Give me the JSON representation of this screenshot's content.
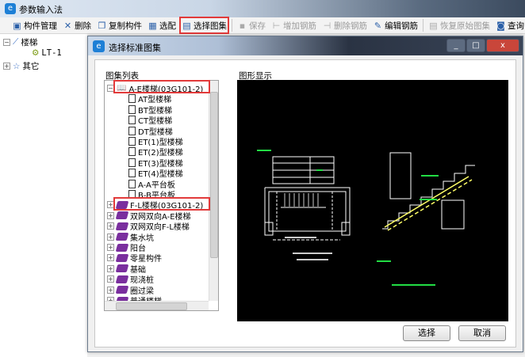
{
  "window": {
    "title": "参数输入法"
  },
  "toolbar": {
    "items": [
      {
        "label": "构件管理",
        "icon": "component-manage-icon",
        "enabled": true
      },
      {
        "label": "删除",
        "icon": "delete-x-icon",
        "enabled": true
      },
      {
        "label": "复制构件",
        "icon": "copy-icon",
        "enabled": true
      },
      {
        "label": "选配",
        "icon": "select-match-icon",
        "enabled": true
      },
      {
        "label": "选择图集",
        "icon": "atlas-icon",
        "enabled": true,
        "highlighted": true
      },
      {
        "label": "保存",
        "icon": "save-icon",
        "enabled": false
      },
      {
        "label": "增加钢筋",
        "icon": "add-rebar-icon",
        "enabled": false
      },
      {
        "label": "删除钢筋",
        "icon": "delete-rebar-icon",
        "enabled": false
      },
      {
        "label": "编辑钢筋",
        "icon": "edit-rebar-icon",
        "enabled": true
      },
      {
        "label": "恢复原始图集",
        "icon": "restore-icon",
        "enabled": false
      },
      {
        "label": "查询",
        "icon": "binoculars-icon",
        "enabled": true
      }
    ]
  },
  "tree": {
    "root": "楼梯",
    "child": "LT-1",
    "other": "其它"
  },
  "dialog": {
    "title": "选择标准图集",
    "list_label": "图集列表",
    "preview_label": "图形显示",
    "list": {
      "expanded": {
        "label": "A-E楼梯(03G101-2)",
        "children": [
          "AT型楼梯",
          "BT型楼梯",
          "CT型楼梯",
          "DT型楼梯",
          "ET(1)型楼梯",
          "ET(2)型楼梯",
          "ET(3)型楼梯",
          "ET(4)型楼梯",
          "A-A平台板",
          "B-B平台板"
        ]
      },
      "collapsed": [
        "F-L楼梯(03G101-2)",
        "双网双向A-E楼梯",
        "双网双向F-L楼梯",
        "集水坑",
        "阳台",
        "零星构件",
        "基础",
        "现浇桩",
        "圈过梁",
        "普通楼梯"
      ]
    },
    "select_button": "选择",
    "cancel_button": "取消"
  },
  "colors": {
    "highlight": "#e23a3a",
    "book": "#7a2f9e",
    "drawing_bg": "#000000",
    "drawing_line": "#ffffff",
    "drawing_accent": "#ffff66",
    "drawing_text": "#22dd44"
  }
}
